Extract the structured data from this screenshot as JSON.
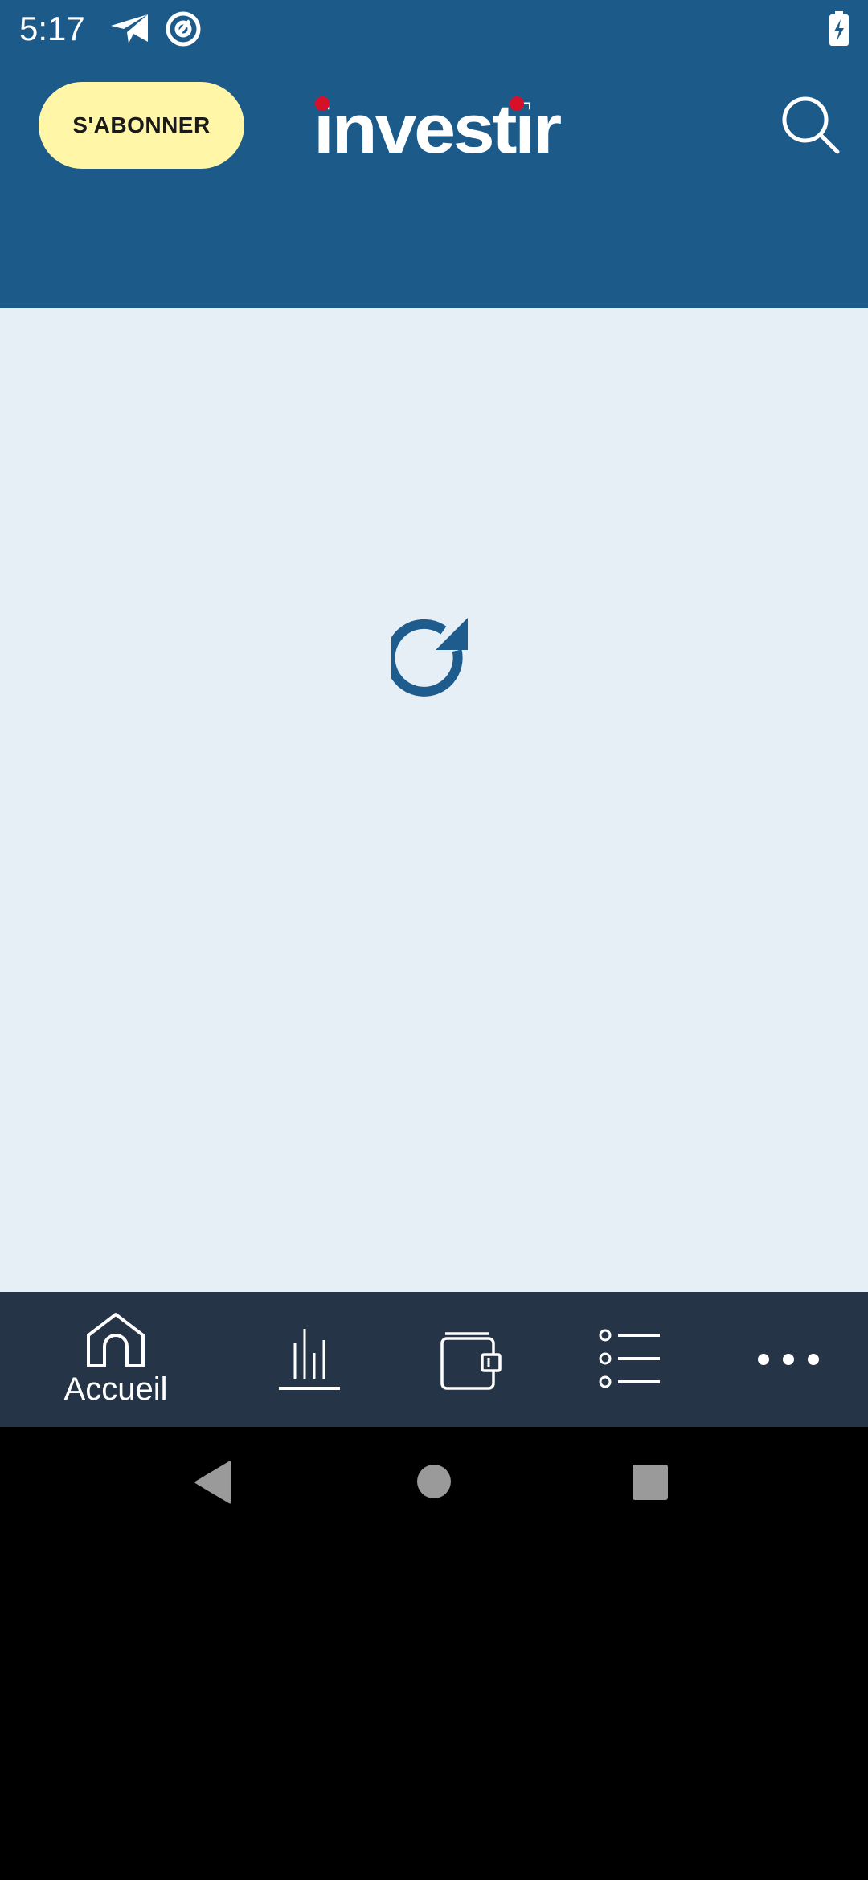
{
  "status_bar": {
    "time": "5:17",
    "icons": [
      "paper-plane-icon",
      "at-sign-icon",
      "battery-charging-icon"
    ]
  },
  "header": {
    "subscribe_label": "S'ABONNER",
    "logo_text": "investir",
    "search_icon": "search-icon",
    "background_color": "#1C5A8A",
    "subscribe_color": "#FFF6A8",
    "logo_dot_color": "#D7102A"
  },
  "content": {
    "background_color": "#E6EEF6",
    "refresh_icon": "refresh-icon"
  },
  "bottom_nav": {
    "background_color": "#253446",
    "items": [
      {
        "label": "Accueil",
        "icon": "home-icon"
      },
      {
        "icon": "bar-chart-icon"
      },
      {
        "icon": "wallet-icon"
      },
      {
        "icon": "list-icon"
      },
      {
        "icon": "more-dots-icon"
      }
    ]
  },
  "system_nav": {
    "buttons": [
      "back-icon",
      "home-circle-icon",
      "recents-icon"
    ]
  }
}
